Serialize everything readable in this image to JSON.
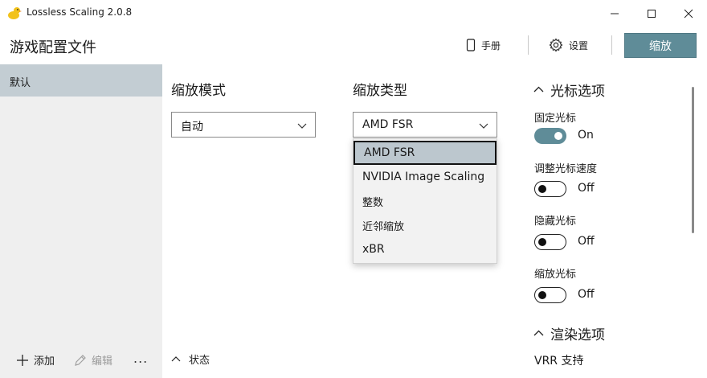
{
  "window": {
    "title": "Lossless Scaling 2.0.8"
  },
  "header": {
    "page_title": "游戏配置文件",
    "manual_label": "手册",
    "settings_label": "设置",
    "scale_button": "缩放"
  },
  "sidebar": {
    "profiles": [
      {
        "label": "默认",
        "selected": true
      }
    ],
    "add_label": "添加",
    "edit_label": "编辑",
    "more_label": "..."
  },
  "scaling_mode": {
    "title": "缩放模式",
    "value": "自动"
  },
  "scaling_type": {
    "title": "缩放类型",
    "value": "AMD FSR",
    "options": [
      "AMD FSR",
      "NVIDIA Image Scaling",
      "整数",
      "近邻缩放",
      "xBR"
    ],
    "highlighted": "AMD FSR"
  },
  "status": {
    "label": "状态"
  },
  "cursor_options": {
    "title": "光标选项",
    "items": [
      {
        "label": "固定光标",
        "state": "On",
        "on": true
      },
      {
        "label": "调整光标速度",
        "state": "Off",
        "on": false
      },
      {
        "label": "隐藏光标",
        "state": "Off",
        "on": false
      },
      {
        "label": "缩放光标",
        "state": "Off",
        "on": false
      }
    ]
  },
  "render_options": {
    "title": "渲染选项",
    "first_item": "VRR 支持"
  },
  "colors": {
    "accent": "#5f8c98",
    "sidebar_bg": "#efefef",
    "selected_profile": "#c3cdd3",
    "dropdown_highlight": "#bcc7ce"
  },
  "icons": {
    "app": "duck-icon",
    "manual": "phone-book-icon",
    "settings": "gear-icon",
    "add": "plus-icon",
    "edit": "pencil-icon",
    "collapse": "chevron-up-icon",
    "dropdown": "chevron-down-icon"
  }
}
